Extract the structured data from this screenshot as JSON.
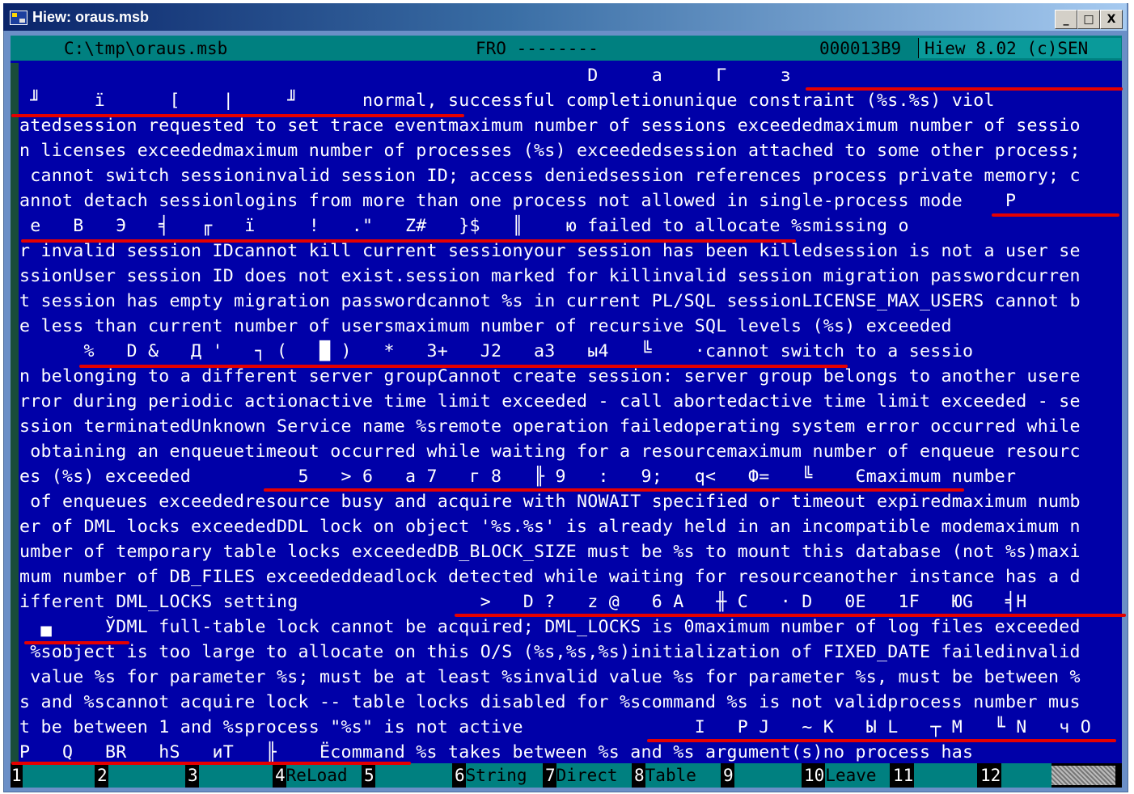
{
  "window": {
    "title": "Hiew: oraus.msb",
    "controls": [
      "_",
      "□",
      "X"
    ]
  },
  "status": {
    "path": "C:\\tmp\\oraus.msb",
    "mode": "FRO --------",
    "offset": "000013B9",
    "version": "Hiew 8.02 (c)SEN"
  },
  "lines": [
    "                                                     D     a     Г     з  ",
    " ╜     ї      [    |     ╜      normal, successful completionunique constraint (%s.%s) viol",
    "atedsession requested to set trace eventmaximum number of sessions exceededmaximum number of sessio",
    "n licenses exceededmaximum number of processes (%s) exceededsession attached to some other process;",
    " cannot switch sessioninvalid session ID; access deniedsession references process private memory; c",
    "annot detach sessionlogins from more than one process not allowed in single-process mode    P  ",
    " e   В   Э   ╡   ╓   ї     !   .\"   Z#   }$   ║    ю failed to allocate %smissing o",
    "r invalid session IDcannot kill current sessionyour session has been killedsession is not a user se",
    "ssionUser session ID does not exist.session marked for killinvalid session migration passwordcurren",
    "t session has empty migration passwordcannot %s in current PL/SQL sessionLICENSE_MAX_USERS cannot b",
    "e less than current number of usersmaximum number of recursive SQL levels (%s) exceeded",
    "      %   D &   Д '   ┐ (   █ )   *   3+   J2   a3   ы4   ╚    ·cannot switch to a sessio",
    "n belonging to a different server groupCannot create session: server group belongs to another usere",
    "rror during periodic actionactive time limit exceeded - call abortedactive time limit exceeded - se",
    "ssion terminatedUnknown Service name %sremote operation failedoperating system error occurred while",
    " obtaining an enqueuetimeout occurred while waiting for a resourcemaximum number of enqueue resourc",
    "es (%s) exceeded          5   > 6   a 7   г 8   ╟ 9   :   9;   q<   Ф=   ╚    Єmaximum number",
    " of enqueues exceededresource busy and acquire with NOWAIT specified or timeout expiredmaximum numb",
    "er of DML locks exceededDDL lock on object '%s.%s' is already held in an incompatible modemaximum n",
    "umber of temporary table locks exceededDB_BLOCK_SIZE must be %s to mount this database (not %s)maxi",
    "mum number of DB_FILES exceededdeadlock detected while waiting for resourceanother instance has a d",
    "ifferent DML_LOCKS setting                 >   D ?   z @   6 A   ╫ C   · D   0E   1F   ЮG   ╡H",
    "  ▄     ЎDML full-table lock cannot be acquired; DML_LOCKS is 0maximum number of log files exceeded",
    " %sobject is too large to allocate on this O/S (%s,%s,%s)initialization of FIXED_DATE failedinvalid",
    " value %s for parameter %s; must be at least %sinvalid value %s for parameter %s, must be between %",
    "s and %scannot acquire lock -- table locks disabled for %scommand %s is not validprocess number mus",
    "t be between 1 and %sprocess \"%s\" is not active                I   P J   ~ K   Ы L   ┬ M   ╙ N   ч O",
    "P   Q   BR   hS   иT   ╟    Ёcommand %s takes between %s and %s argument(s)no process has"
  ],
  "fkeys": [
    {
      "num": "1",
      "label": ""
    },
    {
      "num": "2",
      "label": ""
    },
    {
      "num": "3",
      "label": ""
    },
    {
      "num": "4",
      "label": "ReLoad"
    },
    {
      "num": "5",
      "label": ""
    },
    {
      "num": "6",
      "label": "String"
    },
    {
      "num": "7",
      "label": "Direct"
    },
    {
      "num": "8",
      "label": "Table"
    },
    {
      "num": "9",
      "label": ""
    },
    {
      "num": "10",
      "label": "Leave"
    },
    {
      "num": "11",
      "label": ""
    },
    {
      "num": "12",
      "label": ""
    }
  ],
  "colors": {
    "background": "#0000a8",
    "text": "#ffffff",
    "statusbar": "#008080",
    "annotation": "#e60000"
  }
}
